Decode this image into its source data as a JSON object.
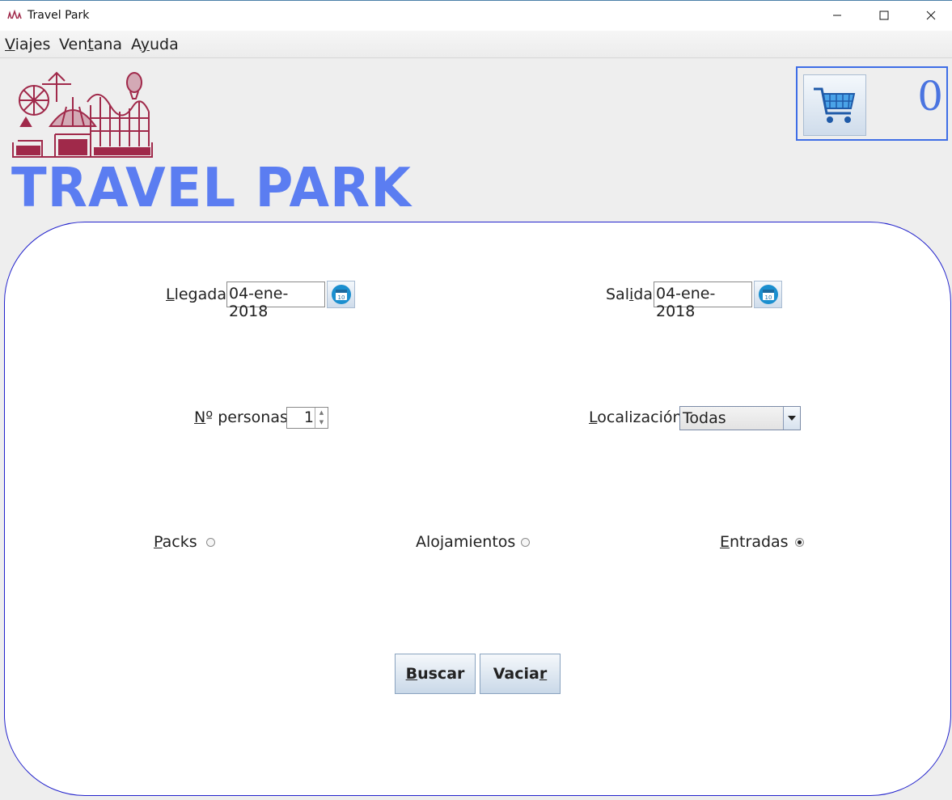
{
  "window": {
    "title": "Travel Park"
  },
  "menu": {
    "viajes": {
      "first": "V",
      "rest": "iajes"
    },
    "ventana": {
      "pre": "Ven",
      "key": "t",
      "post": "ana"
    },
    "ayuda": {
      "pre": "A",
      "key": "y",
      "post": "uda"
    }
  },
  "brand": {
    "name": "TRAVEL PARK"
  },
  "cart": {
    "count": "0",
    "icon": "shopping-cart-icon"
  },
  "form": {
    "llegada": {
      "key": "L",
      "rest": "legada",
      "value": "04-ene-2018"
    },
    "salida": {
      "pre": "Sal",
      "key": "i",
      "post": "da",
      "value": "04-ene-2018"
    },
    "personas": {
      "key": "N",
      "rest": "º personas",
      "value": "1"
    },
    "localizacion": {
      "key": "L",
      "rest": "ocalización",
      "value": "Todas"
    },
    "packs": {
      "key": "P",
      "rest": "acks",
      "selected": false
    },
    "alojamientos": {
      "label": "Alojamientos",
      "selected": false
    },
    "entradas": {
      "key": "E",
      "rest": "ntradas",
      "selected": true
    }
  },
  "buttons": {
    "buscar": {
      "key": "B",
      "rest": "uscar"
    },
    "vaciar": {
      "pre": "Vacia",
      "key": "r"
    }
  },
  "colors": {
    "brand": "#5b7df1",
    "logo": "#a0294a",
    "panel_border": "#2222cc",
    "cart_border": "#3e6de6"
  }
}
